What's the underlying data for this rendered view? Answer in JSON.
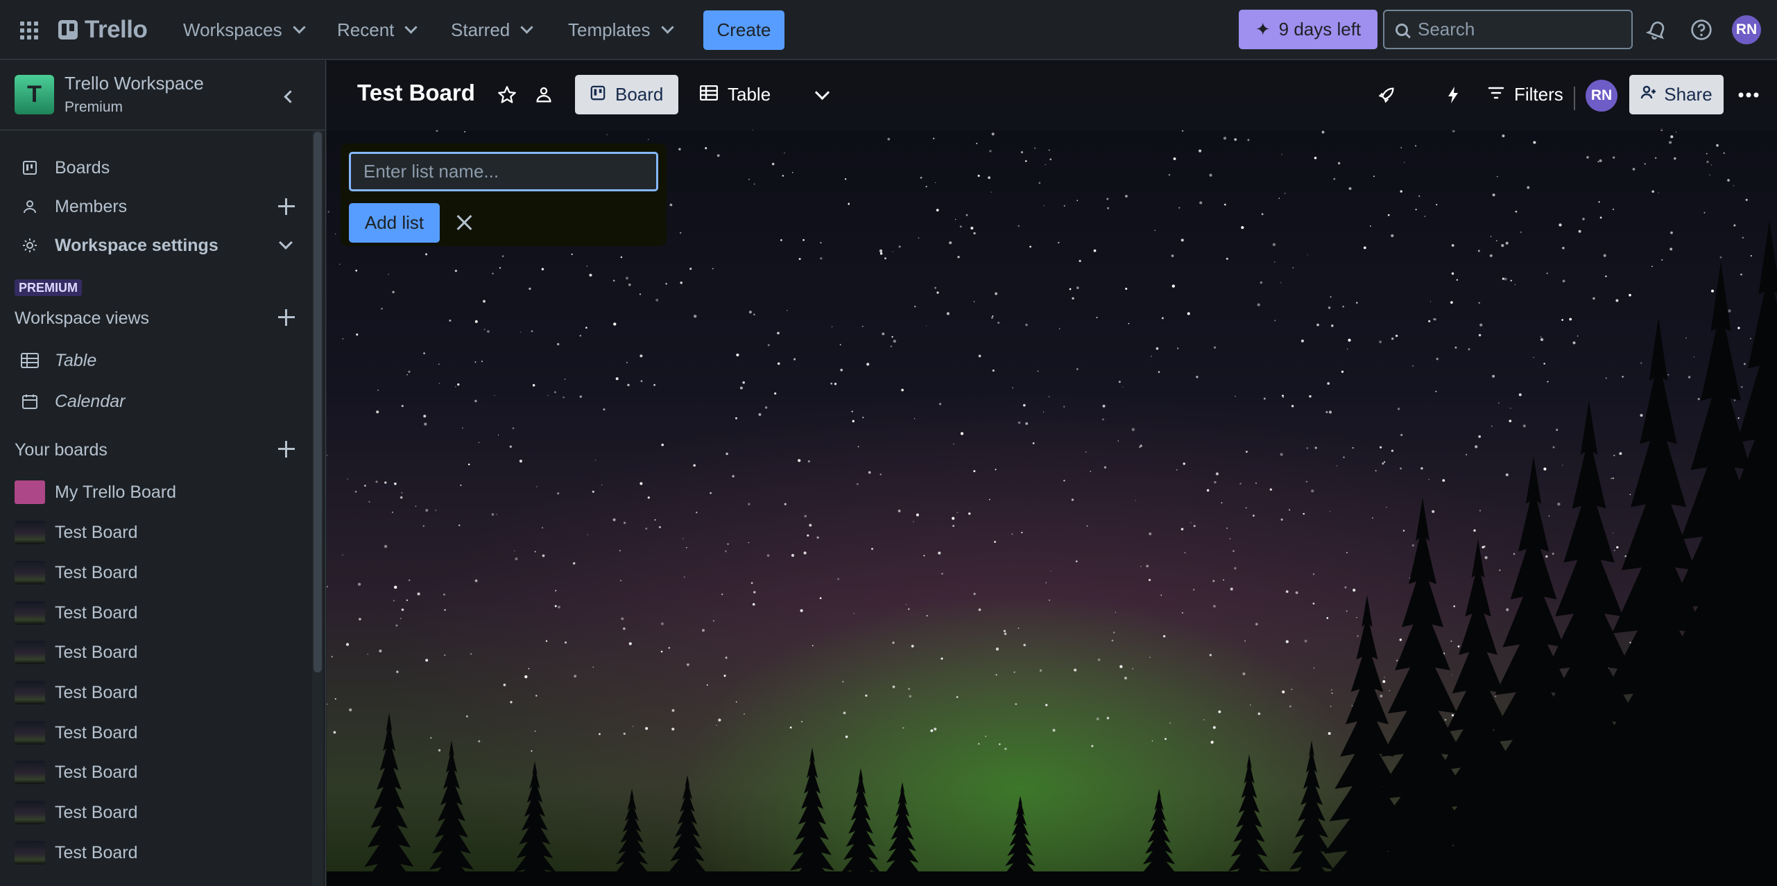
{
  "topnav": {
    "apps_icon": "apps-grid-icon",
    "logo_text": "Trello",
    "menus": [
      {
        "label": "Workspaces"
      },
      {
        "label": "Recent"
      },
      {
        "label": "Starred"
      },
      {
        "label": "Templates"
      }
    ],
    "create_label": "Create",
    "trial_label": "9 days left",
    "search_placeholder": "Search",
    "user_initials": "RN",
    "colors": {
      "accent": "#579dff",
      "trial": "#9f8fef",
      "avatar": "#6e5dc6"
    }
  },
  "sidebar": {
    "workspace_initial": "T",
    "workspace_name": "Trello Workspace",
    "workspace_plan": "Premium",
    "nav": [
      {
        "label": "Boards",
        "icon": "board-icon"
      },
      {
        "label": "Members",
        "icon": "person-icon"
      },
      {
        "label": "Workspace settings",
        "icon": "gear-icon"
      }
    ],
    "premium_badge": "PREMIUM",
    "views_title": "Workspace views",
    "views": [
      {
        "label": "Table",
        "icon": "table-icon"
      },
      {
        "label": "Calendar",
        "icon": "calendar-icon"
      }
    ],
    "boards_title": "Your boards",
    "boards": [
      {
        "label": "My Trello Board",
        "color": "#ae4787"
      },
      {
        "label": "Test Board"
      },
      {
        "label": "Test Board"
      },
      {
        "label": "Test Board"
      },
      {
        "label": "Test Board"
      },
      {
        "label": "Test Board"
      },
      {
        "label": "Test Board"
      },
      {
        "label": "Test Board"
      },
      {
        "label": "Test Board"
      },
      {
        "label": "Test Board"
      }
    ]
  },
  "board": {
    "title": "Test Board",
    "views": [
      {
        "label": "Board",
        "icon": "board-icon"
      },
      {
        "label": "Table",
        "icon": "table-icon"
      }
    ],
    "filters_label": "Filters",
    "member_initials": "RN",
    "share_label": "Share",
    "add_list": {
      "placeholder": "Enter list name...",
      "button_label": "Add list"
    }
  }
}
